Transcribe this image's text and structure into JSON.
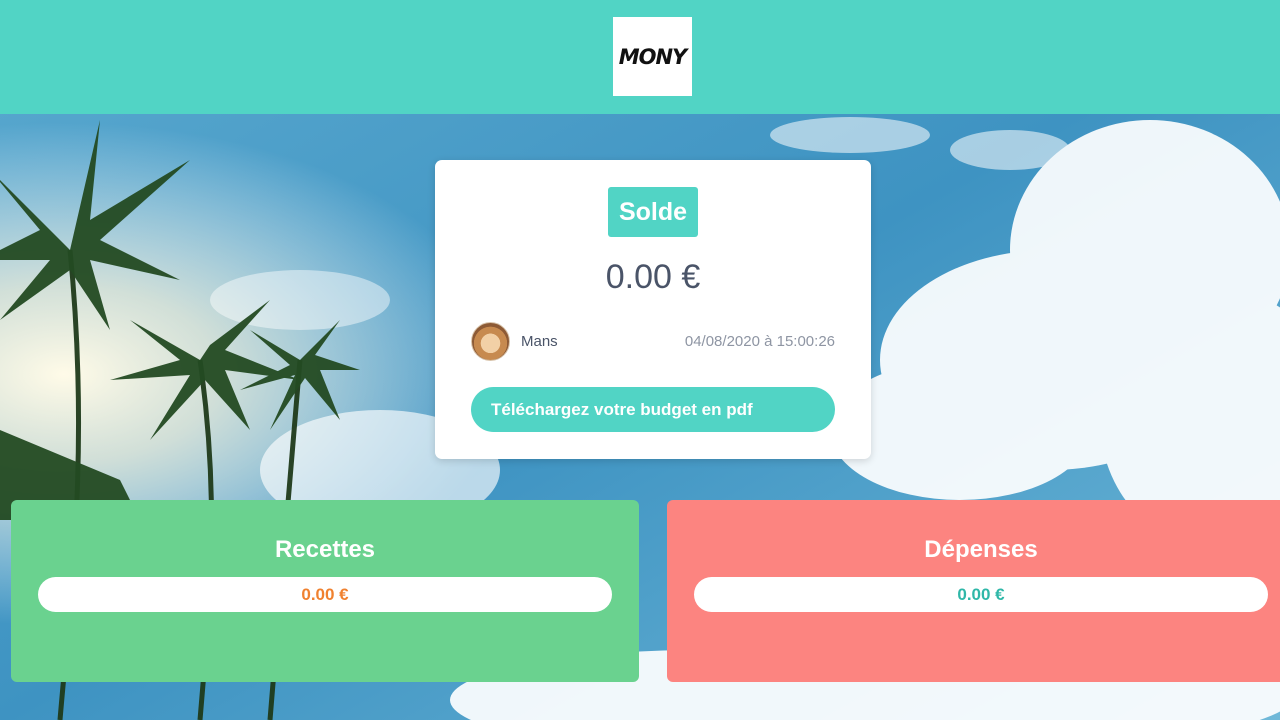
{
  "header": {
    "logo_text": "MONY",
    "brand_color": "#51d4c5"
  },
  "balance_card": {
    "title": "Solde",
    "amount": "0.00 €",
    "user_name": "Mans",
    "timestamp": "04/08/2020 à 15:00:26",
    "download_button_label": "Téléchargez votre budget en pdf"
  },
  "income": {
    "title": "Recettes",
    "amount": "0.00 €",
    "color": "#6ad28f",
    "amount_color": "#f0812f"
  },
  "expenses": {
    "title": "Dépenses",
    "amount": "0.00 €",
    "color": "#fc8480",
    "amount_color": "#2fb7a8"
  }
}
